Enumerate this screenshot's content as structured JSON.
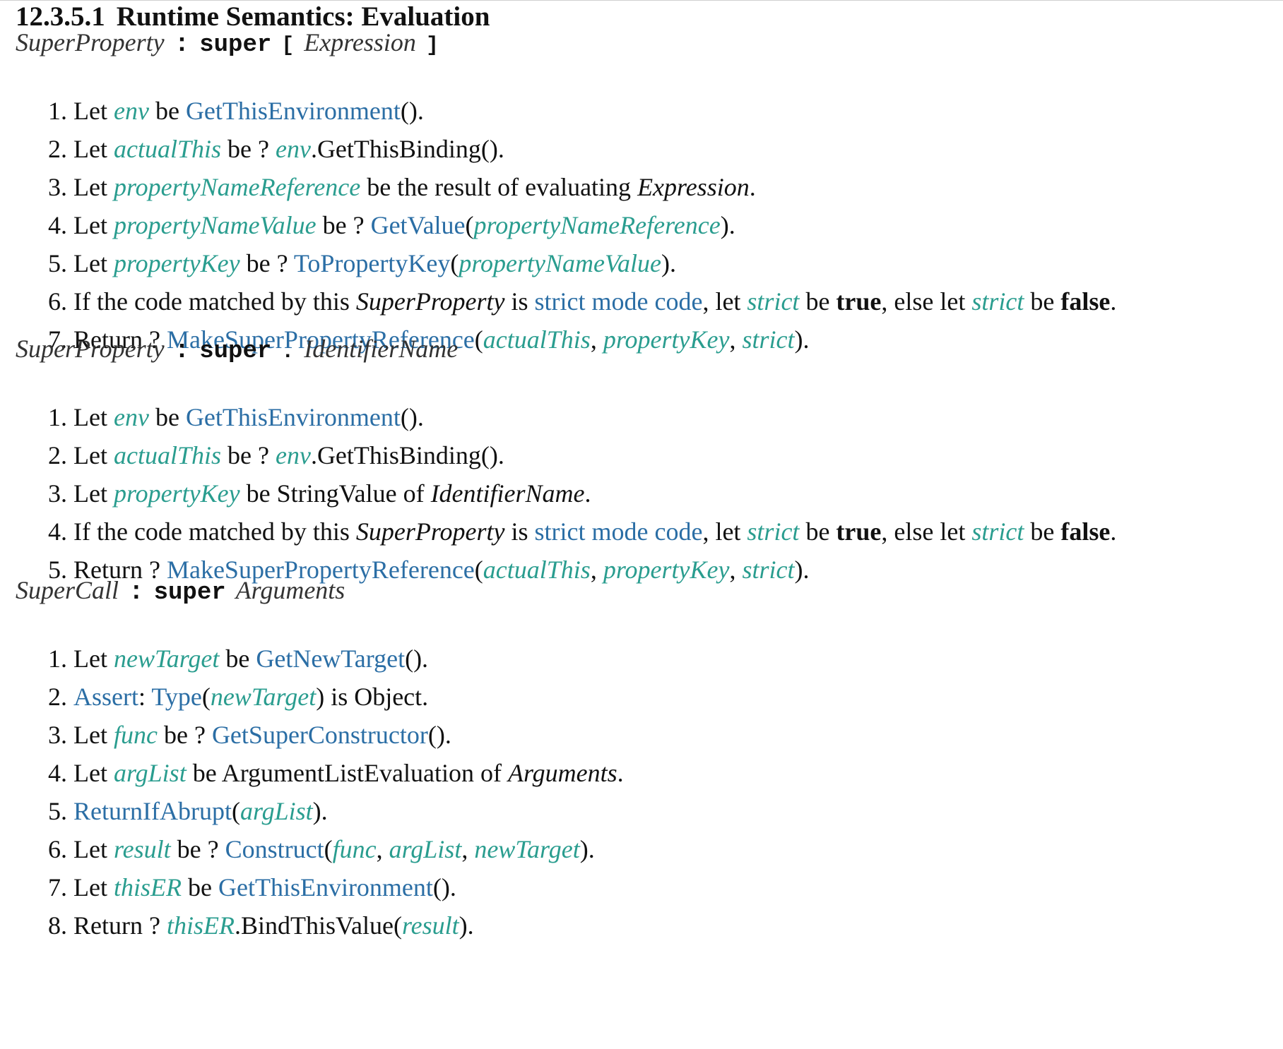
{
  "section": {
    "number": "12.3.5.1",
    "title": "Runtime Semantics: Evaluation"
  },
  "productions": [
    {
      "lhs": "SuperProperty",
      "colon": ":",
      "keyword": "super",
      "punct_open": "[",
      "arg": "Expression",
      "punct_close": "]",
      "steps": [
        [
          [
            "1.",
            "t"
          ],
          [
            "Let ",
            "t"
          ],
          [
            "env",
            "v"
          ],
          [
            " be ",
            "t"
          ],
          [
            "GetThisEnvironment",
            "l"
          ],
          [
            "().",
            "t"
          ]
        ],
        [
          [
            "2.",
            "t"
          ],
          [
            "Let ",
            "t"
          ],
          [
            "actualThis",
            "v"
          ],
          [
            " be ? ",
            "t"
          ],
          [
            "env",
            "v"
          ],
          [
            ".GetThisBinding().",
            "t"
          ]
        ],
        [
          [
            "3.",
            "t"
          ],
          [
            "Let ",
            "t"
          ],
          [
            "propertyNameReference",
            "v"
          ],
          [
            " be the result of evaluating ",
            "t"
          ],
          [
            "Expression",
            "i"
          ],
          [
            ".",
            "t"
          ]
        ],
        [
          [
            "4.",
            "t"
          ],
          [
            "Let ",
            "t"
          ],
          [
            "propertyNameValue",
            "v"
          ],
          [
            " be ? ",
            "t"
          ],
          [
            "GetValue",
            "l"
          ],
          [
            "(",
            "t"
          ],
          [
            "propertyNameReference",
            "v"
          ],
          [
            ").",
            "t"
          ]
        ],
        [
          [
            "5.",
            "t"
          ],
          [
            "Let ",
            "t"
          ],
          [
            "propertyKey",
            "v"
          ],
          [
            " be ? ",
            "t"
          ],
          [
            "ToPropertyKey",
            "l"
          ],
          [
            "(",
            "t"
          ],
          [
            "propertyNameValue",
            "v"
          ],
          [
            ").",
            "t"
          ]
        ],
        [
          [
            "6.",
            "t"
          ],
          [
            "If the code matched by this ",
            "t"
          ],
          [
            "SuperProperty",
            "i"
          ],
          [
            " is ",
            "t"
          ],
          [
            "strict mode code",
            "l"
          ],
          [
            ", let ",
            "t"
          ],
          [
            "strict",
            "v"
          ],
          [
            " be ",
            "t"
          ],
          [
            "true",
            "b"
          ],
          [
            ", else let ",
            "t"
          ],
          [
            "strict",
            "v"
          ],
          [
            " be ",
            "t"
          ],
          [
            "false",
            "b"
          ],
          [
            ".",
            "t"
          ]
        ],
        [
          [
            "7.",
            "t"
          ],
          [
            "Return ? ",
            "t"
          ],
          [
            "MakeSuperPropertyReference",
            "l"
          ],
          [
            "(",
            "t"
          ],
          [
            "actualThis",
            "v"
          ],
          [
            ", ",
            "t"
          ],
          [
            "propertyKey",
            "v"
          ],
          [
            ", ",
            "t"
          ],
          [
            "strict",
            "v"
          ],
          [
            ").",
            "t"
          ]
        ]
      ]
    },
    {
      "lhs": "SuperProperty",
      "colon": ":",
      "keyword": "super",
      "punct_open": ".",
      "arg": "IdentifierName",
      "punct_close": "",
      "steps": [
        [
          [
            "1.",
            "t"
          ],
          [
            "Let ",
            "t"
          ],
          [
            "env",
            "v"
          ],
          [
            " be ",
            "t"
          ],
          [
            "GetThisEnvironment",
            "l"
          ],
          [
            "().",
            "t"
          ]
        ],
        [
          [
            "2.",
            "t"
          ],
          [
            "Let ",
            "t"
          ],
          [
            "actualThis",
            "v"
          ],
          [
            " be ? ",
            "t"
          ],
          [
            "env",
            "v"
          ],
          [
            ".GetThisBinding().",
            "t"
          ]
        ],
        [
          [
            "3.",
            "t"
          ],
          [
            "Let ",
            "t"
          ],
          [
            "propertyKey",
            "v"
          ],
          [
            " be StringValue of ",
            "t"
          ],
          [
            "IdentifierName",
            "i"
          ],
          [
            ".",
            "t"
          ]
        ],
        [
          [
            "4.",
            "t"
          ],
          [
            "If the code matched by this ",
            "t"
          ],
          [
            "SuperProperty",
            "i"
          ],
          [
            " is ",
            "t"
          ],
          [
            "strict mode code",
            "l"
          ],
          [
            ", let ",
            "t"
          ],
          [
            "strict",
            "v"
          ],
          [
            " be ",
            "t"
          ],
          [
            "true",
            "b"
          ],
          [
            ", else let ",
            "t"
          ],
          [
            "strict",
            "v"
          ],
          [
            " be ",
            "t"
          ],
          [
            "false",
            "b"
          ],
          [
            ".",
            "t"
          ]
        ],
        [
          [
            "5.",
            "t"
          ],
          [
            "Return ? ",
            "t"
          ],
          [
            "MakeSuperPropertyReference",
            "l"
          ],
          [
            "(",
            "t"
          ],
          [
            "actualThis",
            "v"
          ],
          [
            ", ",
            "t"
          ],
          [
            "propertyKey",
            "v"
          ],
          [
            ", ",
            "t"
          ],
          [
            "strict",
            "v"
          ],
          [
            ").",
            "t"
          ]
        ]
      ]
    },
    {
      "lhs": "SuperCall",
      "colon": ":",
      "keyword": "super",
      "punct_open": "",
      "arg": "Arguments",
      "punct_close": "",
      "steps": [
        [
          [
            "1.",
            "t"
          ],
          [
            "Let ",
            "t"
          ],
          [
            "newTarget",
            "v"
          ],
          [
            " be ",
            "t"
          ],
          [
            "GetNewTarget",
            "l"
          ],
          [
            "().",
            "t"
          ]
        ],
        [
          [
            "2.",
            "t"
          ],
          [
            "Assert",
            "l"
          ],
          [
            ": ",
            "t"
          ],
          [
            "Type",
            "l"
          ],
          [
            "(",
            "t"
          ],
          [
            "newTarget",
            "v"
          ],
          [
            ") is Object.",
            "t"
          ]
        ],
        [
          [
            "3.",
            "t"
          ],
          [
            "Let ",
            "t"
          ],
          [
            "func",
            "v"
          ],
          [
            " be ? ",
            "t"
          ],
          [
            "GetSuperConstructor",
            "l"
          ],
          [
            "().",
            "t"
          ]
        ],
        [
          [
            "4.",
            "t"
          ],
          [
            "Let ",
            "t"
          ],
          [
            "argList",
            "v"
          ],
          [
            " be ArgumentListEvaluation of ",
            "t"
          ],
          [
            "Arguments",
            "i"
          ],
          [
            ".",
            "t"
          ]
        ],
        [
          [
            "5.",
            "t"
          ],
          [
            "ReturnIfAbrupt",
            "l"
          ],
          [
            "(",
            "t"
          ],
          [
            "argList",
            "v"
          ],
          [
            ").",
            "t"
          ]
        ],
        [
          [
            "6.",
            "t"
          ],
          [
            "Let ",
            "t"
          ],
          [
            "result",
            "v"
          ],
          [
            " be ? ",
            "t"
          ],
          [
            "Construct",
            "l"
          ],
          [
            "(",
            "t"
          ],
          [
            "func",
            "v"
          ],
          [
            ", ",
            "t"
          ],
          [
            "argList",
            "v"
          ],
          [
            ", ",
            "t"
          ],
          [
            "newTarget",
            "v"
          ],
          [
            ").",
            "t"
          ]
        ],
        [
          [
            "7.",
            "t"
          ],
          [
            "Let ",
            "t"
          ],
          [
            "thisER",
            "v"
          ],
          [
            " be ",
            "t"
          ],
          [
            "GetThisEnvironment",
            "l"
          ],
          [
            "().",
            "t"
          ]
        ],
        [
          [
            "8.",
            "t"
          ],
          [
            "Return ? ",
            "t"
          ],
          [
            "thisER",
            "v"
          ],
          [
            ".BindThisValue(",
            "t"
          ],
          [
            "result",
            "v"
          ],
          [
            ").",
            "t"
          ]
        ]
      ]
    }
  ]
}
